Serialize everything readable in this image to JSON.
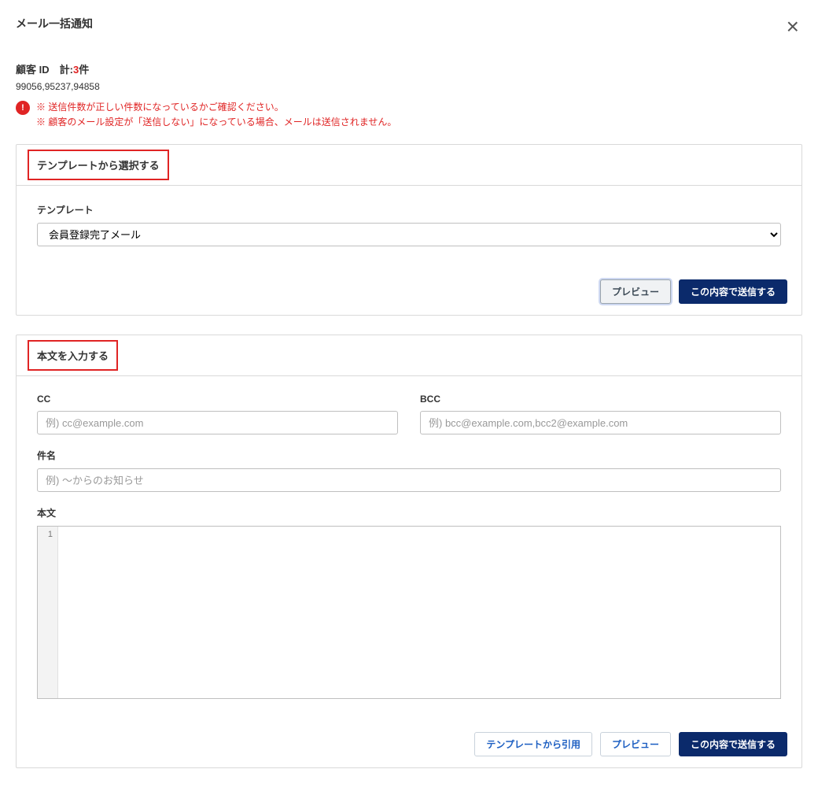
{
  "title": "メール一括通知",
  "summary": {
    "prefix": "顧客 ID　計:",
    "count": "3",
    "suffix": "件",
    "ids": "99056,95237,94858"
  },
  "warning": {
    "icon": "!",
    "line1": "※ 送信件数が正しい件数になっているかご確認ください。",
    "line2": "※ 顧客のメール設定が「送信しない」になっている場合、メールは送信されません。"
  },
  "section1": {
    "header": "テンプレートから選択する",
    "template_label": "テンプレート",
    "template_selected": "会員登録完了メール",
    "preview_label": "プレビュー",
    "send_label": "この内容で送信する"
  },
  "section2": {
    "header": "本文を入力する",
    "cc_label": "CC",
    "cc_placeholder": "例) cc@example.com",
    "bcc_label": "BCC",
    "bcc_placeholder": "例) bcc@example.com,bcc2@example.com",
    "subject_label": "件名",
    "subject_placeholder": "例) 〜からのお知らせ",
    "body_label": "本文",
    "gutter_line": "1",
    "import_template_label": "テンプレートから引用",
    "preview_label": "プレビュー",
    "send_label": "この内容で送信する"
  }
}
